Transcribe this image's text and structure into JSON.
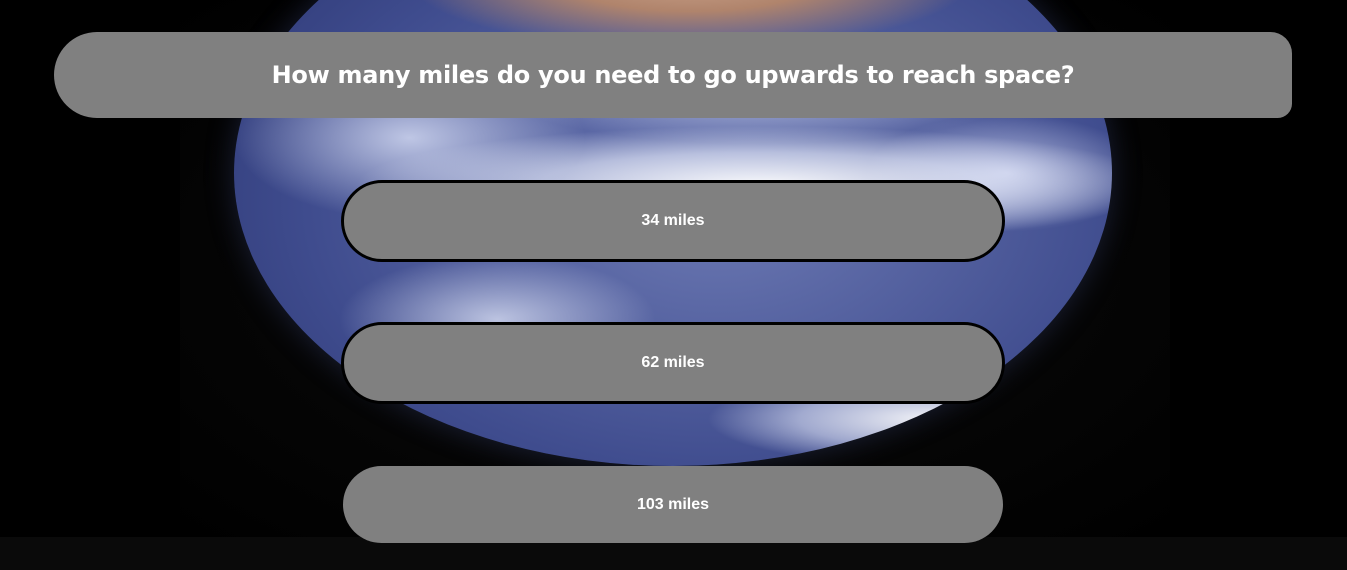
{
  "quiz": {
    "question": "How many miles do you need to go upwards to reach space?",
    "answers": [
      {
        "label": "34 miles"
      },
      {
        "label": "62 miles"
      },
      {
        "label": "103 miles"
      }
    ]
  },
  "background": {
    "image": "earth-from-space",
    "color": "#000000"
  },
  "colors": {
    "panel": "#808080",
    "text": "#ffffff",
    "border": "#000000"
  }
}
